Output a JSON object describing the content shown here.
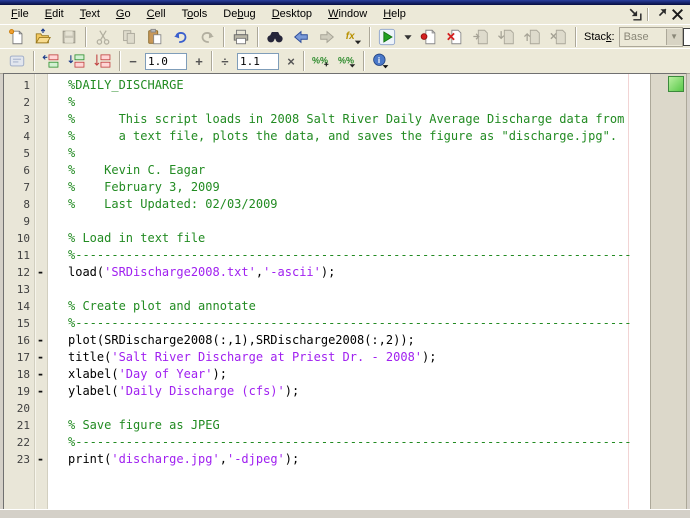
{
  "colors": {
    "comment": "#228B22",
    "string": "#A020F0",
    "code": "#000000",
    "toolbar_bg": "#ece9d8",
    "lint_indicator": "#58c848",
    "margin_line": "#f2d4d4"
  },
  "window": {
    "controls": [
      {
        "icon": "dock-icon"
      },
      {
        "icon": "undock-icon"
      },
      {
        "icon": "close-icon"
      }
    ]
  },
  "menu_bar": {
    "items": [
      {
        "label": "File",
        "mn": 0
      },
      {
        "label": "Edit",
        "mn": 0
      },
      {
        "label": "Text",
        "mn": 0
      },
      {
        "label": "Go",
        "mn": 0
      },
      {
        "label": "Cell",
        "mn": 0
      },
      {
        "label": "Tools",
        "mn": 1
      },
      {
        "label": "Debug",
        "mn": 2
      },
      {
        "label": "Desktop",
        "mn": 0
      },
      {
        "label": "Window",
        "mn": 0
      },
      {
        "label": "Help",
        "mn": 0
      }
    ]
  },
  "toolbar_main": {
    "buttons": [
      {
        "i": "new-file"
      },
      {
        "i": "open-file"
      },
      {
        "i": "save",
        "d": true
      },
      "|",
      {
        "i": "cut",
        "d": true
      },
      {
        "i": "copy",
        "d": true
      },
      {
        "i": "paste"
      },
      {
        "i": "undo"
      },
      {
        "i": "redo",
        "d": true
      },
      "|",
      {
        "i": "print"
      },
      "|",
      {
        "i": "find"
      },
      {
        "i": "go-back"
      },
      {
        "i": "go-forward",
        "d": true
      },
      {
        "i": "function-browser"
      },
      "|",
      {
        "i": "run"
      },
      {
        "i": "run-dropdown",
        "narrow": true
      },
      {
        "i": "set-clear-breakpoint"
      },
      {
        "i": "clear-all-breakpoints"
      },
      {
        "i": "step",
        "d": true
      },
      {
        "i": "step-in",
        "d": true
      },
      {
        "i": "step-out",
        "d": true
      },
      {
        "i": "exit-debug",
        "d": true
      },
      "|"
    ],
    "stack_label": "Stack:",
    "stack_mn": 4,
    "stack_value": "Base"
  },
  "cell_toolbar": {
    "left_buttons": [
      {
        "i": "cell-mode",
        "d": true
      },
      "|",
      {
        "i": "evaluate-cell"
      },
      {
        "i": "evaluate-cell-advance"
      },
      {
        "i": "evaluate-file"
      },
      "|"
    ],
    "minus_label": "−",
    "plus_label": "+",
    "divide_label": "÷",
    "multiply_label": "×",
    "increment_value": "1.0",
    "factor_value": "1.1",
    "right_buttons": [
      {
        "i": "insert-cell-divider"
      },
      {
        "i": "cell-menu"
      },
      "|",
      {
        "i": "info-menu"
      }
    ]
  },
  "editor": {
    "lint_status": "no-errors",
    "lines": [
      {
        "n": 1,
        "x": false,
        "s": [
          {
            "t": "%DAILY_DISCHARGE",
            "c": "cm"
          }
        ]
      },
      {
        "n": 2,
        "x": false,
        "s": [
          {
            "t": "%",
            "c": "cm"
          }
        ]
      },
      {
        "n": 3,
        "x": false,
        "s": [
          {
            "t": "%      This script loads in 2008 Salt River Daily Average Discharge data from",
            "c": "cm"
          }
        ]
      },
      {
        "n": 4,
        "x": false,
        "s": [
          {
            "t": "%      a text file, plots the data, and saves the figure as \"discharge.jpg\".",
            "c": "cm"
          }
        ]
      },
      {
        "n": 5,
        "x": false,
        "s": [
          {
            "t": "%",
            "c": "cm"
          }
        ]
      },
      {
        "n": 6,
        "x": false,
        "s": [
          {
            "t": "%    Kevin C. Eagar",
            "c": "cm"
          }
        ]
      },
      {
        "n": 7,
        "x": false,
        "s": [
          {
            "t": "%    February 3, 2009",
            "c": "cm"
          }
        ]
      },
      {
        "n": 8,
        "x": false,
        "s": [
          {
            "t": "%    Last Updated: 02/03/2009",
            "c": "cm"
          }
        ]
      },
      {
        "n": 9,
        "x": false,
        "s": []
      },
      {
        "n": 10,
        "x": false,
        "s": [
          {
            "t": "% Load in text file",
            "c": "cm"
          }
        ]
      },
      {
        "n": 11,
        "x": false,
        "s": [
          {
            "t": "%-----------------------------------------------------------------------------",
            "c": "cm"
          }
        ]
      },
      {
        "n": 12,
        "x": true,
        "s": [
          {
            "t": "load(",
            "c": "co"
          },
          {
            "t": "'SRDischarge2008.txt'",
            "c": "st"
          },
          {
            "t": ",",
            "c": "co"
          },
          {
            "t": "'-ascii'",
            "c": "st"
          },
          {
            "t": ");",
            "c": "co"
          }
        ]
      },
      {
        "n": 13,
        "x": false,
        "s": []
      },
      {
        "n": 14,
        "x": false,
        "s": [
          {
            "t": "% Create plot and annotate",
            "c": "cm"
          }
        ]
      },
      {
        "n": 15,
        "x": false,
        "s": [
          {
            "t": "%-----------------------------------------------------------------------------",
            "c": "cm"
          }
        ]
      },
      {
        "n": 16,
        "x": true,
        "s": [
          {
            "t": "plot(SRDischarge2008(:,1),SRDischarge2008(:,2));",
            "c": "co"
          }
        ]
      },
      {
        "n": 17,
        "x": true,
        "s": [
          {
            "t": "title(",
            "c": "co"
          },
          {
            "t": "'Salt River Discharge at Priest Dr. - 2008'",
            "c": "st"
          },
          {
            "t": ");",
            "c": "co"
          }
        ]
      },
      {
        "n": 18,
        "x": true,
        "s": [
          {
            "t": "xlabel(",
            "c": "co"
          },
          {
            "t": "'Day of Year'",
            "c": "st"
          },
          {
            "t": ");",
            "c": "co"
          }
        ]
      },
      {
        "n": 19,
        "x": true,
        "s": [
          {
            "t": "ylabel(",
            "c": "co"
          },
          {
            "t": "'Daily Discharge (cfs)'",
            "c": "st"
          },
          {
            "t": ");",
            "c": "co"
          }
        ]
      },
      {
        "n": 20,
        "x": false,
        "s": []
      },
      {
        "n": 21,
        "x": false,
        "s": [
          {
            "t": "% Save figure as JPEG",
            "c": "cm"
          }
        ]
      },
      {
        "n": 22,
        "x": false,
        "s": [
          {
            "t": "%-----------------------------------------------------------------------------",
            "c": "cm"
          }
        ]
      },
      {
        "n": 23,
        "x": true,
        "s": [
          {
            "t": "print(",
            "c": "co"
          },
          {
            "t": "'discharge.jpg'",
            "c": "st"
          },
          {
            "t": ",",
            "c": "co"
          },
          {
            "t": "'-djpeg'",
            "c": "st"
          },
          {
            "t": ");",
            "c": "co"
          }
        ]
      }
    ]
  }
}
